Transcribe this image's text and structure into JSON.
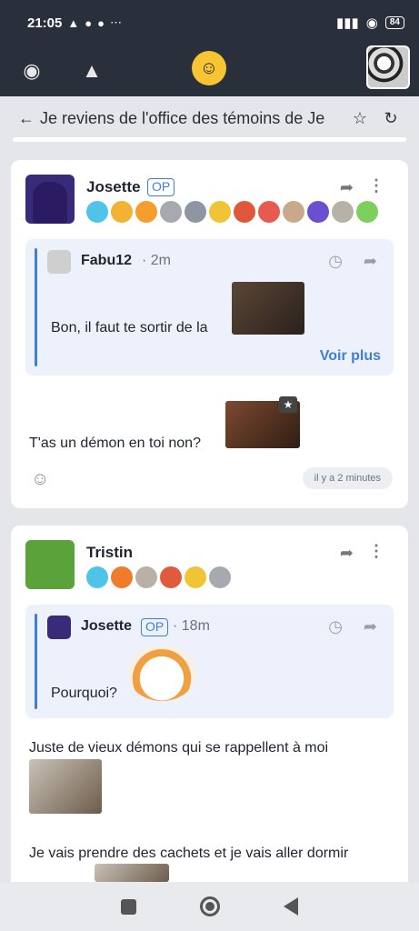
{
  "statusbar": {
    "time": "21:05",
    "battery": "84",
    "icons": [
      "game-icon",
      "facebook-icon",
      "messenger-icon",
      "more-dots-icon"
    ]
  },
  "topic": {
    "title": "Je reviens de l'office des témoins de Je"
  },
  "posts": [
    {
      "author": "Josette",
      "op": "OP",
      "quote": {
        "author": "Fabu12",
        "time": "2m",
        "text": "Bon, il faut te sortir de la",
        "more": "Voir plus"
      },
      "text": "T'as un démon en toi non?",
      "timestamp": "il y a 2 minutes"
    },
    {
      "author": "Tristin",
      "quote": {
        "author": "Josette",
        "op": "OP",
        "time": "18m",
        "text": "Pourquoi?"
      },
      "text1": "Juste de vieux démons qui se rappellent à moi",
      "text2": "Je vais prendre des cachets et je vais aller dormir"
    }
  ],
  "separator": "·",
  "colors": {
    "accent": "#3f7fd8",
    "header": "#2a2f3c"
  }
}
